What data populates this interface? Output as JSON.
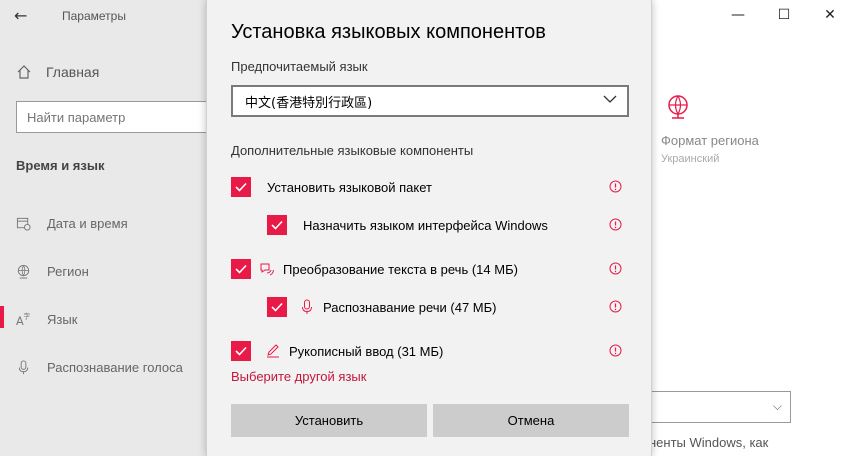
{
  "app": {
    "title": "Параметры"
  },
  "sidebar": {
    "home_label": "Главная",
    "search_placeholder": "Найти параметр",
    "section_title": "Время и язык",
    "items": [
      {
        "label": "Дата и время",
        "icon": "calendar-clock-icon"
      },
      {
        "label": "Регион",
        "icon": "globe-icon"
      },
      {
        "label": "Язык",
        "icon": "language-icon",
        "active": true
      },
      {
        "label": "Распознавание голоса",
        "icon": "microphone-icon"
      }
    ]
  },
  "main": {
    "region_title": "Формат региона",
    "region_subtitle": "Украинский",
    "partial_text": "ненты Windows, как"
  },
  "dialog": {
    "title": "Установка языковых компонентов",
    "preferred_label": "Предпочитаемый язык",
    "selected_language": "中文(香港特別行政區)",
    "optional_label": "Дополнительные языковые компоненты",
    "options": [
      {
        "label": "Установить языковой пакет",
        "checked": true
      },
      {
        "label": "Назначить языком интерфейса Windows",
        "checked": true
      },
      {
        "label": "Преобразование текста в речь (14 МБ)",
        "checked": true,
        "icon": "speech-icon"
      },
      {
        "label": "Распознавание речи (47 МБ)",
        "checked": true,
        "icon": "microphone-icon"
      },
      {
        "label": "Рукописный ввод (31 МБ)",
        "checked": true,
        "icon": "pen-icon"
      }
    ],
    "choose_other_link": "Выберите другой язык",
    "install_label": "Установить",
    "cancel_label": "Отмена"
  },
  "colors": {
    "accent": "#e81a48",
    "link": "#c4173c"
  }
}
